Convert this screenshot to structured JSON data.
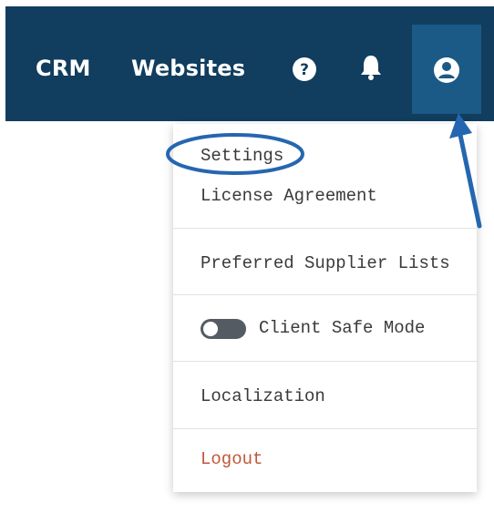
{
  "topbar": {
    "nav": [
      {
        "label": "CRM"
      },
      {
        "label": "Websites"
      }
    ],
    "icons": [
      "help-icon",
      "bell-icon",
      "user-icon"
    ]
  },
  "menu": {
    "items": [
      {
        "label": "Settings"
      },
      {
        "label": "License Agreement"
      },
      {
        "label": "Preferred Supplier Lists"
      },
      {
        "label": "Client Safe Mode",
        "toggle": false
      },
      {
        "label": "Localization"
      },
      {
        "label": "Logout"
      }
    ]
  },
  "colors": {
    "topbar": "#113d5e",
    "user_button_active": "#1b5a86",
    "annotation": "#2566b0",
    "logout": "#c0573a"
  }
}
